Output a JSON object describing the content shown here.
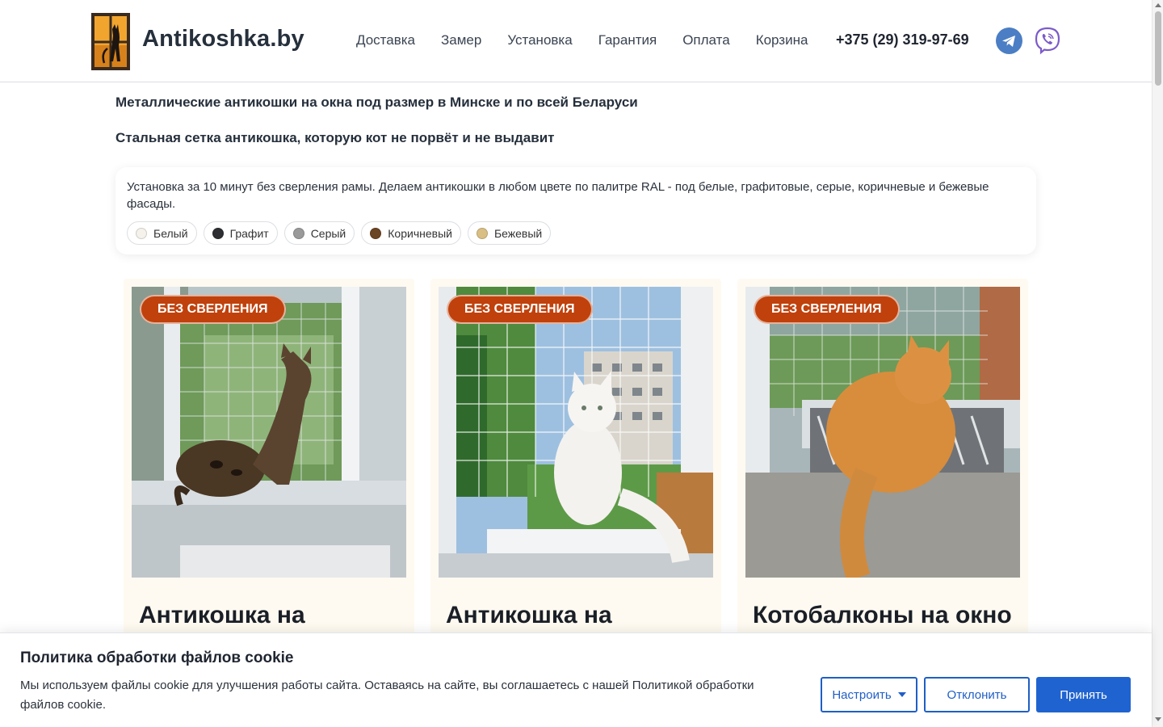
{
  "header": {
    "brand": "Antikoshka.by",
    "nav": [
      "Доставка",
      "Замер",
      "Установка",
      "Гарантия",
      "Оплата",
      "Корзина"
    ],
    "phone": "+375 (29) 319-97-69",
    "icons": [
      "logo-window-cat-icon",
      "telegram-icon",
      "viber-icon"
    ]
  },
  "headings": {
    "line1": "Металлические антикошки на окна под размер в Минске и по всей Беларуси",
    "line2": "Стальная сетка антикошка, которую кот не порвёт и не выдавит"
  },
  "info": {
    "text": "Установка за 10 минут без сверления рамы. Делаем антикошки в любом цвете по палитре RAL - под белые, графитовые, серые, коричневые и бежевые фасады.",
    "colors": [
      {
        "label": "Белый",
        "hex": "#f4f2ea"
      },
      {
        "label": "Графит",
        "hex": "#2d2f33"
      },
      {
        "label": "Серый",
        "hex": "#9a9a9a"
      },
      {
        "label": "Коричневый",
        "hex": "#6b4423"
      },
      {
        "label": "Бежевый",
        "hex": "#d9bf84"
      }
    ]
  },
  "products": [
    {
      "badge": "БЕЗ СВЕРЛЕНИЯ",
      "title": "Антикошка на"
    },
    {
      "badge": "БЕЗ СВЕРЛЕНИЯ",
      "title": "Антикошка на"
    },
    {
      "badge": "БЕЗ СВЕРЛЕНИЯ",
      "title": "Котобалконы на окно"
    }
  ],
  "cookie": {
    "title": "Политика обработки файлов cookie",
    "text": "Мы используем файлы cookie для улучшения работы сайта. Оставаясь на сайте, вы соглашаетесь с нашей Политикой обработки файлов cookie.",
    "settings": "Настроить",
    "decline": "Отклонить",
    "accept": "Принять"
  },
  "colors": {
    "accent": "#1f63d0",
    "badge": "#c0410c",
    "card_bg": "#fffaf1"
  }
}
